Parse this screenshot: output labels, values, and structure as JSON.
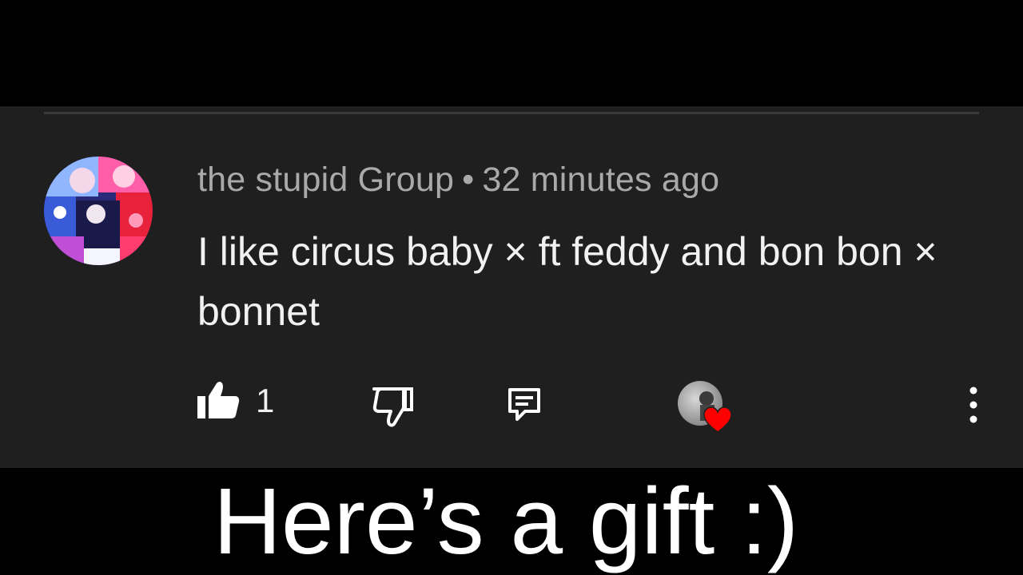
{
  "comment": {
    "author": "the stupid Group",
    "separator": "•",
    "timestamp": "32 minutes ago",
    "text": "I like circus baby × ft feddy and bon bon × bonnet"
  },
  "actions": {
    "like_count": "1",
    "icons": {
      "like": "thumbs-up-icon",
      "dislike": "thumbs-down-icon",
      "reply": "reply-comment-icon",
      "creator_heart": "heart-icon",
      "more": "vertical-dots-icon"
    }
  },
  "caption": {
    "text": "Here’s a gift :)"
  },
  "colors": {
    "background": "#000000",
    "card": "#1f1f1f",
    "meta_text": "#a9a9a9",
    "body_text": "#f1f1f1",
    "heart": "#ff0000",
    "caption": "#ffffff"
  }
}
